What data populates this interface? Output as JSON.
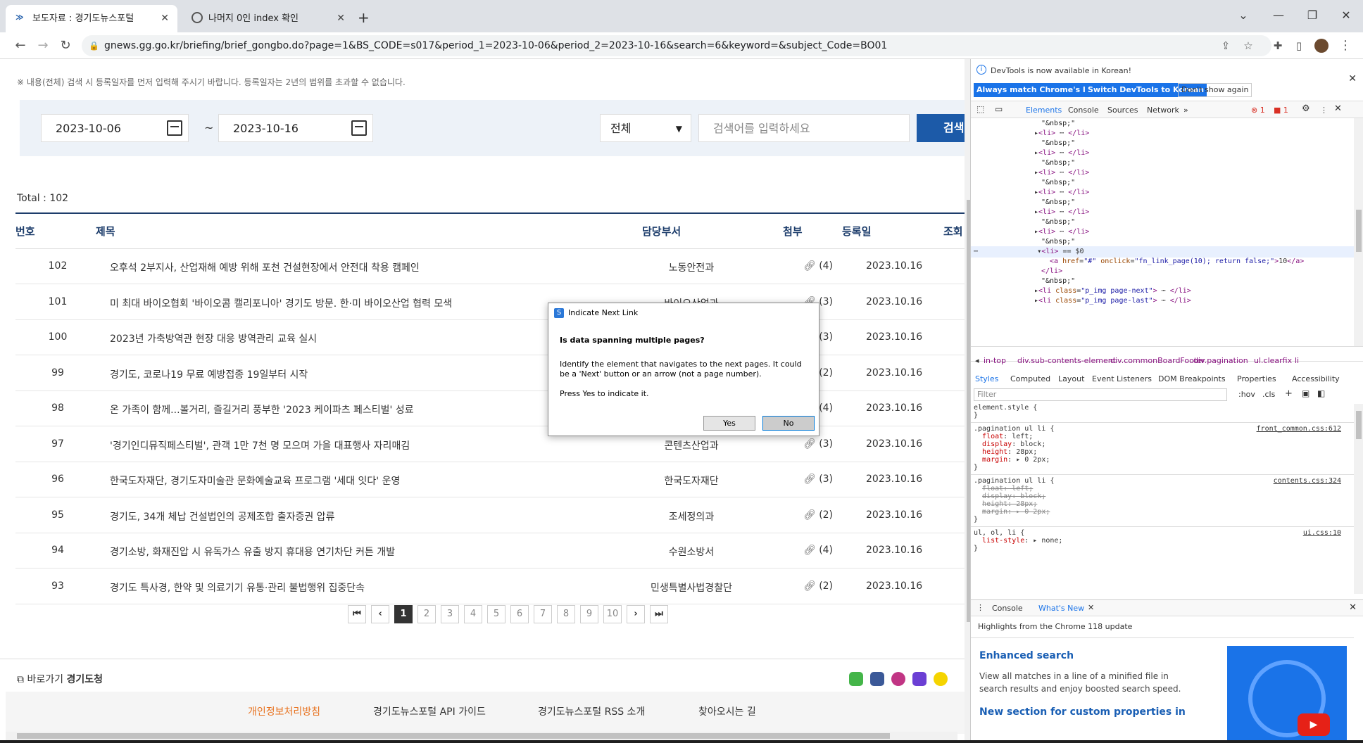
{
  "browser": {
    "tabs": [
      {
        "title": "보도자료 : 경기도뉴스포털"
      },
      {
        "title": "나머지 0인 index 확인"
      }
    ],
    "url": "gnews.gg.go.kr/briefing/brief_gongbo.do?page=1&BS_CODE=s017&period_1=2023-10-06&period_2=2023-10-16&search=6&keyword=&subject_Code=BO01"
  },
  "page": {
    "note1": "※ 내용(전체) 검색 시 등록일자를 먼저 입력해 주시기 바랍니다. 등록일자는 2년의 범위를 초과할 수 없습니다.",
    "search": {
      "date_from": "2023-10-06",
      "tilde": "~",
      "date_to": "2023-10-16",
      "select_value": "전체",
      "keyword_placeholder": "검색어를 입력하세요",
      "button": "검색"
    },
    "total": "Total : 102",
    "columns": {
      "no": "번호",
      "title": "제목",
      "dept": "담당부서",
      "attach": "첨부",
      "date": "등록일",
      "views": "조회"
    },
    "rows": [
      {
        "no": "102",
        "title": "오후석 2부지사, 산업재해 예방 위해 포천 건설현장에서 안전대 착용 캠페인",
        "dept": "노동안전과",
        "attach": "(4)",
        "date": "2023.10.16"
      },
      {
        "no": "101",
        "title": "미 최대 바이오협회 '바이오콤 캘리포니아' 경기도 방문. 한·미 바이오산업 협력 모색",
        "dept": "바이오산업과",
        "attach": "(3)",
        "date": "2023.10.16"
      },
      {
        "no": "100",
        "title": "2023년 가축방역관 현장 대응 방역관리 교육 실시",
        "dept": "",
        "attach": "(3)",
        "date": "2023.10.16"
      },
      {
        "no": "99",
        "title": "경기도, 코로나19 무료 예방접종 19일부터 시작",
        "dept": "",
        "attach": "(2)",
        "date": "2023.10.16"
      },
      {
        "no": "98",
        "title": "온 가족이 함께...볼거리, 즐길거리 풍부한 '2023 케이파츠 페스티벌' 성료",
        "dept": "",
        "attach": "(4)",
        "date": "2023.10.16"
      },
      {
        "no": "97",
        "title": "'경기인디뮤직페스티벌', 관객 1만 7천 명 모으며 가을 대표행사 자리매김",
        "dept": "콘텐츠산업과",
        "attach": "(3)",
        "date": "2023.10.16"
      },
      {
        "no": "96",
        "title": "한국도자재단, 경기도자미술관 문화예술교육 프로그램 '세대 잇다' 운영",
        "dept": "한국도자재단",
        "attach": "(3)",
        "date": "2023.10.16"
      },
      {
        "no": "95",
        "title": "경기도, 34개 체납 건설법인의 공제조합 출자증권 압류",
        "dept": "조세정의과",
        "attach": "(2)",
        "date": "2023.10.16"
      },
      {
        "no": "94",
        "title": "경기소방, 화재진압 시 유독가스 유출 방지 휴대용 연기차단 커튼 개발",
        "dept": "수원소방서",
        "attach": "(4)",
        "date": "2023.10.16"
      },
      {
        "no": "93",
        "title": "경기도 특사경, 한약 및 의료기기 유통·관리 불법행위 집중단속",
        "dept": "민생특별사법경찰단",
        "attach": "(2)",
        "date": "2023.10.16"
      }
    ],
    "pager": {
      "first": "⏮",
      "prev": "‹",
      "pages": [
        "1",
        "2",
        "3",
        "4",
        "5",
        "6",
        "7",
        "8",
        "9",
        "10"
      ],
      "next": "›",
      "last": "⏭"
    },
    "footer": {
      "shortcut": "바로가기",
      "shortcut_site": "경기도청",
      "links": [
        "개인정보처리방침",
        "경기도뉴스포털 API 가이드",
        "경기도뉴스포털 RSS 소개",
        "찾아오시는 길"
      ]
    }
  },
  "dialog": {
    "title": "Indicate Next Link",
    "question": "Is data spanning multiple pages?",
    "body": "Identify the element that navigates to the next pages. It could be a 'Next' button or an arrow (not a page number).",
    "press": "Press Yes to indicate it.",
    "yes": "Yes",
    "no": "No"
  },
  "devtools": {
    "banner": "DevTools is now available in Korean!",
    "btn1": "Always match Chrome's language",
    "btn2": "Switch DevTools to Korean",
    "btn3": "Don't show again",
    "tabs": [
      "Elements",
      "Console",
      "Sources",
      "Network"
    ],
    "errors": "1",
    "warnings": "1",
    "breadcrumbs": [
      "in-top",
      "div.sub-contents-element",
      "div.commonBoardFooter",
      "div.pagination",
      "ul.clearfix",
      "li"
    ],
    "style_tabs": [
      "Styles",
      "Computed",
      "Layout",
      "Event Listeners",
      "DOM Breakpoints",
      "Properties",
      "Accessibility"
    ],
    "filter_placeholder": "Filter",
    "hov": ":hov",
    "cls": ".cls",
    "css_src1": "front_common.css:612",
    "css_src2": "contents.css:324",
    "css_src3": "ui.css:10",
    "drawer_tabs": [
      "Console",
      "What's New"
    ],
    "whats_new_heading": "Highlights from the Chrome 118 update",
    "enhanced_title": "Enhanced search",
    "enhanced_body": "View all matches in a line of a minified file in search results and enjoy boosted search speed.",
    "next_title": "New section for custom properties in"
  }
}
